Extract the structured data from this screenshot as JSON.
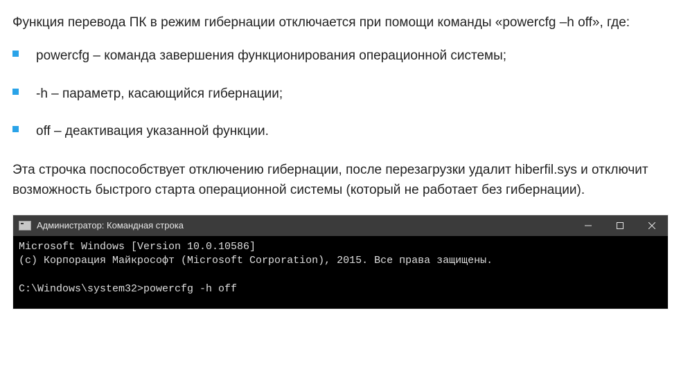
{
  "intro": "Функция перевода ПК в режим гибернации отключается при помощи команды «powercfg –h off», где:",
  "bullets": [
    "powercfg – команда завершения функционирования операционной системы;",
    "-h – параметр, касающийся гибернации;",
    "off – деактивация указанной функции."
  ],
  "outro": "Эта строчка поспособствует отключению гибернации, после перезагрузки удалит hiberfil.sys и отключит возможность быстрого старта операционной системы (который не работает без гибернации).",
  "terminal": {
    "title": "Администратор: Командная строка",
    "lines": {
      "l1": "Microsoft Windows [Version 10.0.10586]",
      "l2": "(c) Корпорация Майкрософт (Microsoft Corporation), 2015. Все права защищены.",
      "l3": "",
      "l4": "C:\\Windows\\system32>powercfg -h off"
    }
  }
}
